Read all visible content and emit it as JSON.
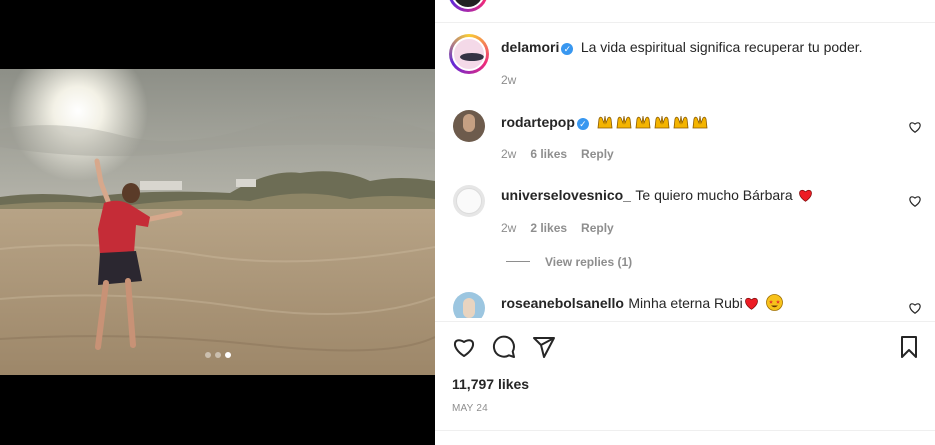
{
  "post": {
    "author": "delamori",
    "caption": "La vida espiritual significa recuperar tu poder.",
    "caption_age": "2w",
    "likes_text": "11,797 likes",
    "date_text": "MAY 24",
    "carousel_total": 3,
    "carousel_active": 3
  },
  "comments": [
    {
      "username": "rodartepop",
      "verified": true,
      "text": "",
      "emoji": "raising-hands-emoji x6",
      "age": "2w",
      "likes": "6 likes",
      "reply": "Reply"
    },
    {
      "username": "universelovesnico_",
      "verified": false,
      "text": "Te quiero mucho Bárbara",
      "emoji": "red-heart-emoji",
      "age": "2w",
      "likes": "2 likes",
      "reply": "Reply",
      "view_replies": "View replies (1)"
    },
    {
      "username": "roseanebolsanello",
      "verified": false,
      "text": "Minha eterna Rubi",
      "emoji": "red-heart-emoji, star-struck-emoji"
    }
  ],
  "colors": {
    "verified": "#3897f0",
    "muted": "#8e8e8e",
    "text": "#262626",
    "heart": "#ed1c24"
  },
  "icons": [
    "heart-icon",
    "comment-icon",
    "share-icon",
    "save-icon"
  ]
}
